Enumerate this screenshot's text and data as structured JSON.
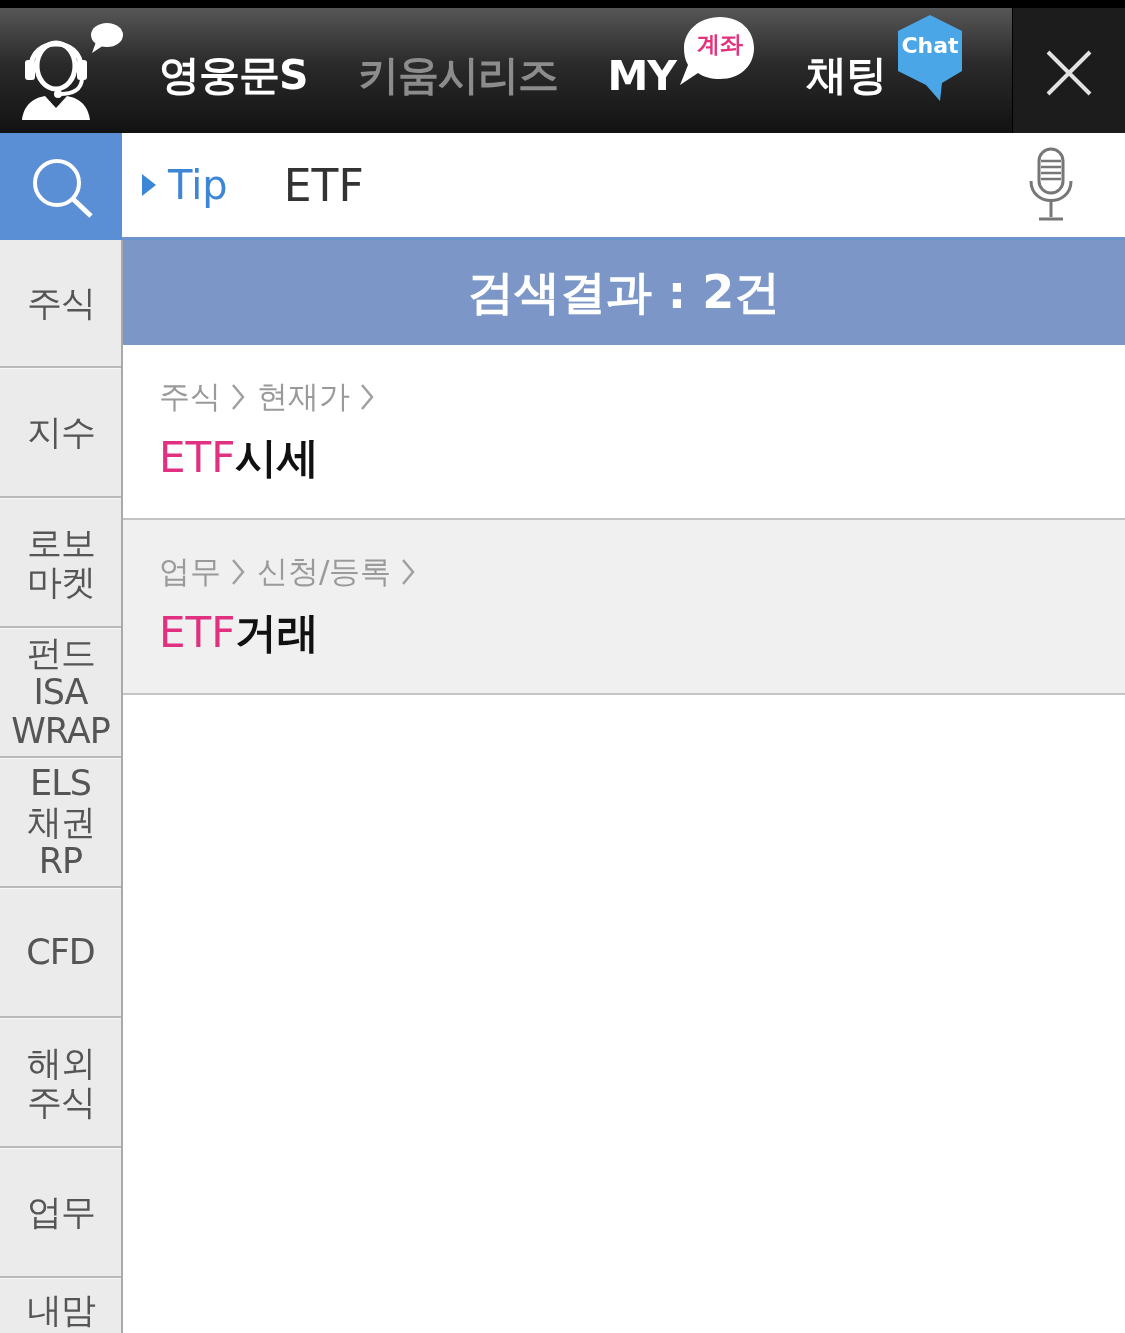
{
  "header": {
    "tabs": [
      {
        "label": "영웅문S",
        "disabled": false
      },
      {
        "label": "키움시리즈",
        "disabled": true
      },
      {
        "label": "MY",
        "disabled": false,
        "badge": {
          "kind": "bubble",
          "text": "계좌"
        }
      },
      {
        "label": "채팅",
        "disabled": false,
        "badge": {
          "kind": "hexagon",
          "text": "Chat"
        }
      }
    ]
  },
  "search": {
    "tip_label": "Tip",
    "value": "ETF"
  },
  "sidebar": {
    "items": [
      {
        "label": "주식",
        "selected": false
      },
      {
        "label": "지수",
        "selected": false
      },
      {
        "label": "로보\n마켓",
        "selected": false
      },
      {
        "label": "펀드\nISA\nWRAP",
        "selected": false
      },
      {
        "label": "ELS\n채권\nRP",
        "selected": false
      },
      {
        "label": "CFD",
        "selected": false
      },
      {
        "label": "해외\n주식",
        "selected": false
      },
      {
        "label": "업무",
        "selected": false
      },
      {
        "label": "내맘",
        "selected": false
      }
    ]
  },
  "results": {
    "heading": "검색결과 : 2건",
    "items": [
      {
        "path": [
          "주식",
          "현재가"
        ],
        "title_parts": [
          {
            "text": "ETF",
            "highlighted": true
          },
          {
            "text": "시세",
            "highlighted": false
          }
        ]
      },
      {
        "path": [
          "업무",
          "신청/등록"
        ],
        "title_parts": [
          {
            "text": "ETF",
            "highlighted": true
          },
          {
            "text": "거래",
            "highlighted": false
          }
        ]
      }
    ]
  }
}
